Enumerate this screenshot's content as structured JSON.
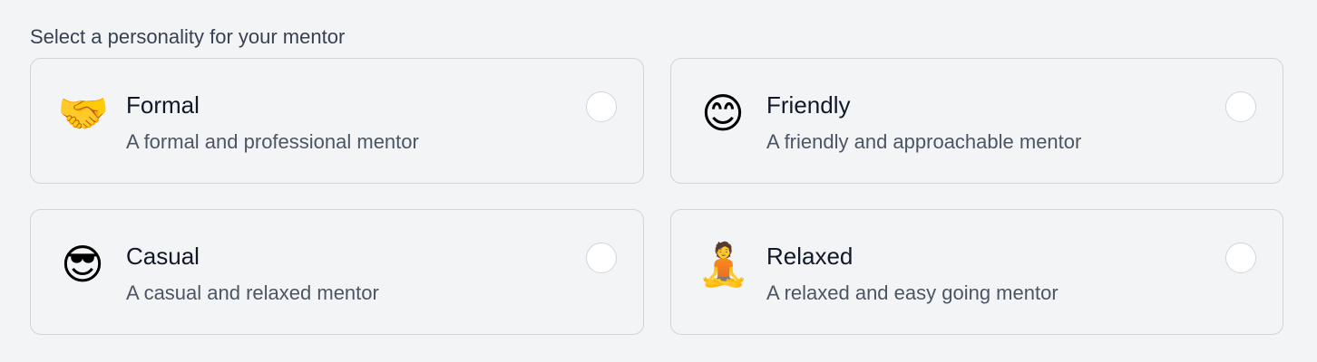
{
  "heading": "Select a personality for your mentor",
  "options": [
    {
      "icon": "🤝",
      "icon_name": "handshake-icon",
      "title": "Formal",
      "description": "A formal and professional mentor",
      "selected": false
    },
    {
      "icon": "😊",
      "icon_name": "smiling-face-icon",
      "title": "Friendly",
      "description": "A friendly and approachable mentor",
      "selected": false
    },
    {
      "icon": "😎",
      "icon_name": "sunglasses-face-icon",
      "title": "Casual",
      "description": "A casual and relaxed mentor",
      "selected": false
    },
    {
      "icon": "🧘",
      "icon_name": "meditation-icon",
      "title": "Relaxed",
      "description": "A relaxed and easy going mentor",
      "selected": false
    }
  ],
  "colors": {
    "background": "#f3f4f6",
    "card_border": "#d1d5db",
    "title_text": "#111827",
    "description_text": "#4b5563",
    "radio_fill": "#ffffff"
  }
}
